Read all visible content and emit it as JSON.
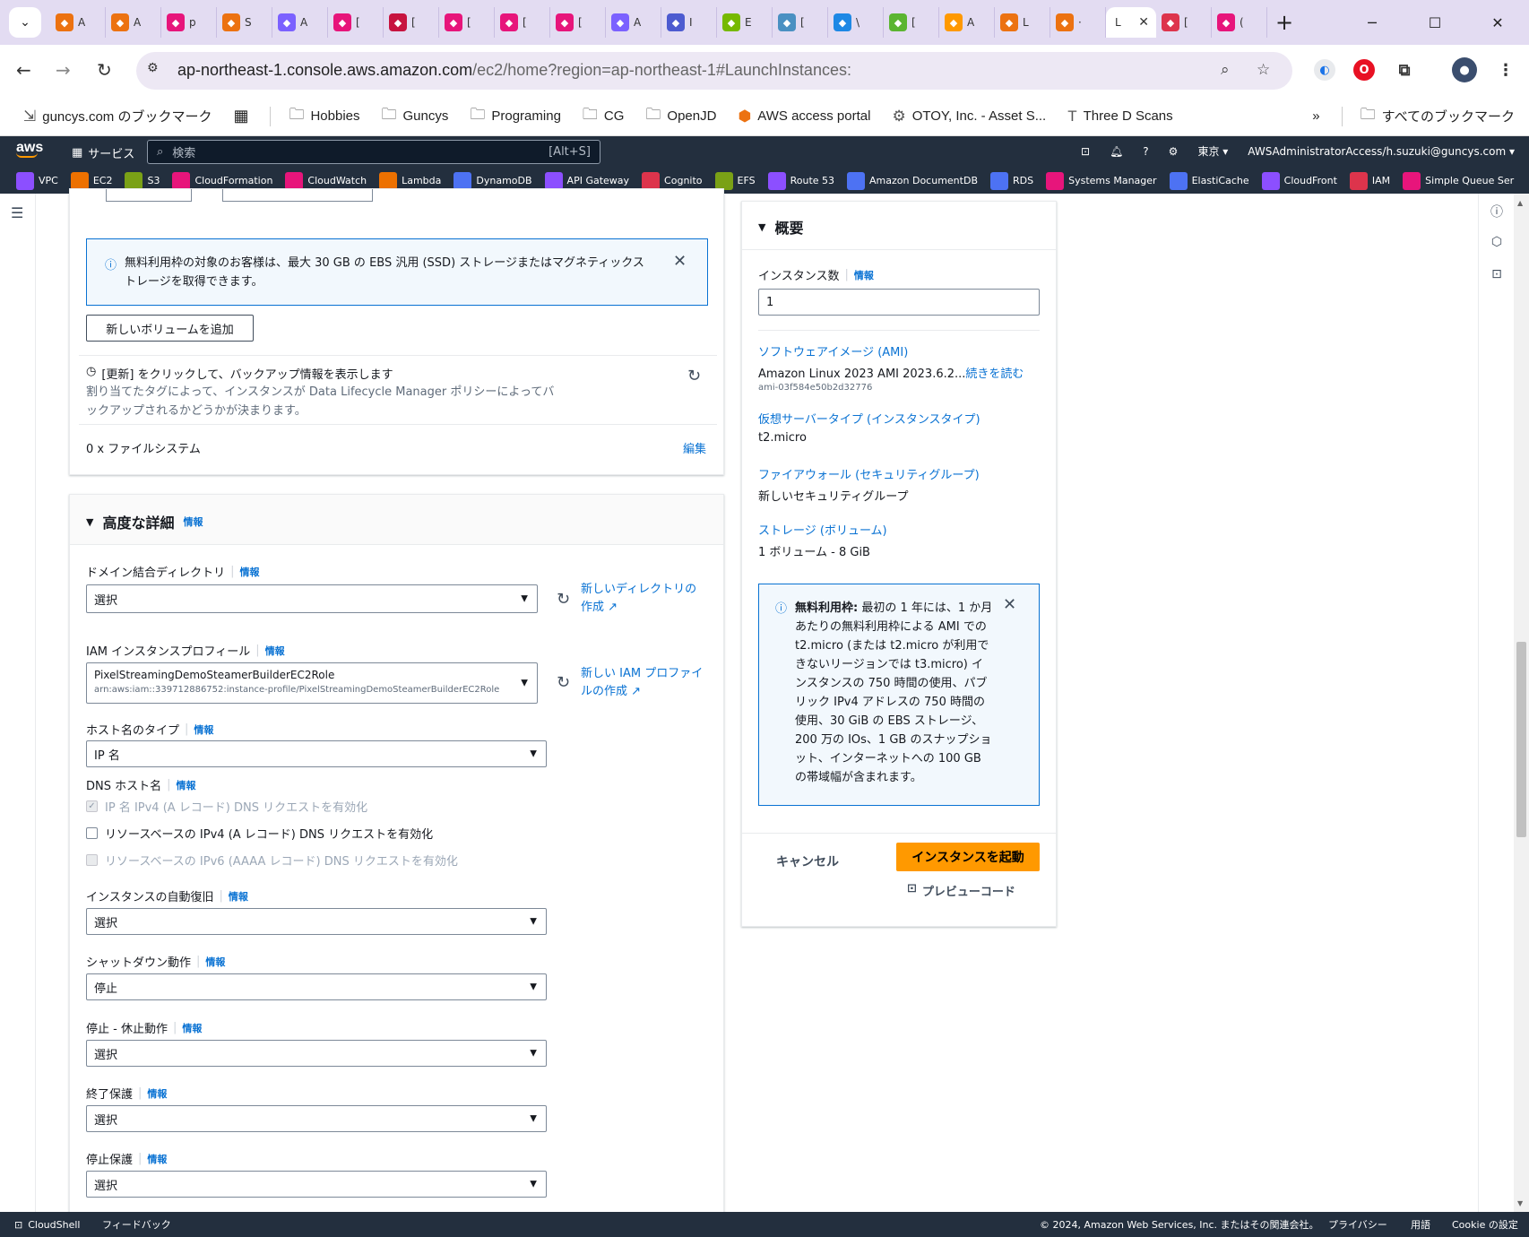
{
  "browser": {
    "tabs": [
      {
        "label": "A",
        "color": "#ec7211"
      },
      {
        "label": "A",
        "color": "#ec7211"
      },
      {
        "label": "p",
        "color": "#e7157b"
      },
      {
        "label": "S",
        "color": "#ec7211"
      },
      {
        "label": "A",
        "color": "#7b61ff"
      },
      {
        "label": "[",
        "color": "#e7157b"
      },
      {
        "label": "[",
        "color": "#c7133f"
      },
      {
        "label": "[",
        "color": "#e7157b"
      },
      {
        "label": "[",
        "color": "#e7157b"
      },
      {
        "label": "[",
        "color": "#e7157b"
      },
      {
        "label": "A",
        "color": "#7b61ff"
      },
      {
        "label": "I",
        "color": "#4d5bd0"
      },
      {
        "label": "E",
        "color": "#76b900"
      },
      {
        "label": "[",
        "color": "#4a90c2"
      },
      {
        "label": "\\",
        "color": "#1e88e5"
      },
      {
        "label": "[",
        "color": "#5bb531"
      },
      {
        "label": "A",
        "color": "#ff9900"
      },
      {
        "label": "L",
        "color": "#ec7211"
      },
      {
        "label": "·",
        "color": "#ec7211"
      }
    ],
    "active_tab": {
      "label": "L"
    },
    "tabs_after": [
      {
        "label": "[",
        "color": "#dd344c"
      },
      {
        "label": "(",
        "color": "#e7157b"
      }
    ],
    "url_host": "ap-northeast-1.console.aws.amazon.com",
    "url_path": "/ec2/home?region=ap-northeast-1#LaunchInstances:",
    "bookmarks": [
      {
        "label": "guncys.com のブックマーク",
        "icon": "import-icon"
      },
      {
        "label": "Hobbies",
        "icon": "folder-icon"
      },
      {
        "label": "Guncys",
        "icon": "folder-icon"
      },
      {
        "label": "Programing",
        "icon": "folder-icon"
      },
      {
        "label": "CG",
        "icon": "folder-icon"
      },
      {
        "label": "OpenJD",
        "icon": "folder-icon"
      },
      {
        "label": "AWS access portal",
        "icon": "aws-box-icon"
      },
      {
        "label": "OTOY, Inc. - Asset S...",
        "icon": "otoy-icon"
      },
      {
        "label": "Three D Scans",
        "icon": "t-icon"
      }
    ],
    "all_bookmarks": "すべてのブックマーク"
  },
  "aws_nav": {
    "services": "サービス",
    "search_placeholder": "検索",
    "search_shortcut": "[Alt+S]",
    "region": "東京 ▾",
    "account": "AWSAdministratorAccess/h.suzuki@guncys.com ▾",
    "favorites": [
      {
        "label": "VPC",
        "color": "#8c4fff"
      },
      {
        "label": "EC2",
        "color": "#ed7100"
      },
      {
        "label": "S3",
        "color": "#7aa116"
      },
      {
        "label": "CloudFormation",
        "color": "#e7157b"
      },
      {
        "label": "CloudWatch",
        "color": "#e7157b"
      },
      {
        "label": "Lambda",
        "color": "#ed7100"
      },
      {
        "label": "DynamoDB",
        "color": "#4d72f3"
      },
      {
        "label": "API Gateway",
        "color": "#8c4fff"
      },
      {
        "label": "Cognito",
        "color": "#dd344c"
      },
      {
        "label": "EFS",
        "color": "#7aa116"
      },
      {
        "label": "Route 53",
        "color": "#8c4fff"
      },
      {
        "label": "Amazon DocumentDB",
        "color": "#4d72f3"
      },
      {
        "label": "RDS",
        "color": "#4d72f3"
      },
      {
        "label": "Systems Manager",
        "color": "#e7157b"
      },
      {
        "label": "ElastiCache",
        "color": "#4d72f3"
      },
      {
        "label": "CloudFront",
        "color": "#8c4fff"
      },
      {
        "label": "IAM",
        "color": "#dd344c"
      },
      {
        "label": "Simple Queue Ser",
        "color": "#e7157b"
      }
    ]
  },
  "storage": {
    "free_tier_alert": "無料利用枠の対象のお客様は、最大 30 GB の EBS 汎用 (SSD) ストレージまたはマグネティックストレージを取得できます。",
    "add_volume": "新しいボリュームを追加",
    "backup_title": "[更新] をクリックして、バックアップ情報を表示します",
    "backup_desc": "割り当てたタグによって、インスタンスが Data Lifecycle Manager ポリシーによってバックアップされるかどうかが決まります。",
    "filesystems": "0 x ファイルシステム",
    "edit": "編集"
  },
  "advanced": {
    "title": "高度な詳細",
    "info": "情報",
    "domain_label": "ドメイン結合ディレクトリ",
    "domain_value": "選択",
    "new_directory": "新しいディレクトリの作成",
    "iam_label": "IAM インスタンスプロフィール",
    "iam_value": "PixelStreamingDemoSteamerBuilderEC2Role",
    "iam_arn": "arn:aws:iam::339712886752:instance-profile/PixelStreamingDemoSteamerBuilderEC2Role",
    "new_iam": "新しい IAM プロファイルの作成",
    "hostname_label": "ホスト名のタイプ",
    "hostname_value": "IP 名",
    "dns_label": "DNS ホスト名",
    "dns_opt1": "IP 名 IPv4 (A レコード) DNS リクエストを有効化",
    "dns_opt2": "リソースベースの IPv4 (A レコード) DNS リクエストを有効化",
    "dns_opt3": "リソースベースの IPv6 (AAAA レコード) DNS リクエストを有効化",
    "recovery_label": "インスタンスの自動復旧",
    "recovery_value": "選択",
    "shutdown_label": "シャットダウン動作",
    "shutdown_value": "停止",
    "hibernate_label": "停止 - 休止動作",
    "hibernate_value": "選択",
    "termination_label": "終了保護",
    "termination_value": "選択",
    "stop_label": "停止保護",
    "stop_value": "選択"
  },
  "summary": {
    "title": "概要",
    "count_label": "インスタンス数",
    "info": "情報",
    "count_value": "1",
    "ami_link": "ソフトウェアイメージ (AMI)",
    "ami_value": "Amazon Linux 2023 AMI 2023.6.2...",
    "read_more": "続きを読む",
    "ami_id": "ami-03f584e50b2d32776",
    "type_link": "仮想サーバータイプ (インスタンスタイプ)",
    "type_value": "t2.micro",
    "fw_link": "ファイアウォール (セキュリティグループ)",
    "fw_value": "新しいセキュリティグループ",
    "storage_link": "ストレージ (ボリューム)",
    "storage_value": "1 ボリューム - 8 GiB",
    "free_bold": "無料利用枠:",
    "free_text": "最初の 1 年には、1 か月あたりの無料利用枠による AMI での t2.micro (または t2.micro が利用できないリージョンでは t3.micro) インスタンスの 750 時間の使用、パブリック IPv4 アドレスの 750 時間の使用、30 GiB の EBS ストレージ、200 万の IOs、1 GB のスナップショット、インターネットへの 100 GB の帯域幅が含まれます。",
    "cancel": "キャンセル",
    "launch": "インスタンスを起動",
    "preview": "プレビューコード"
  },
  "footer": {
    "cloudshell": "CloudShell",
    "feedback": "フィードバック",
    "copyright": "© 2024, Amazon Web Services, Inc. またはその関連会社。",
    "privacy": "プライバシー",
    "terms": "用語",
    "cookie": "Cookie の設定"
  },
  "colors": {
    "aws_dark": "#232f3e",
    "primary_orange": "#ff9900",
    "link_blue": "#0972d3",
    "tab_strip": "#e3dcf2"
  }
}
